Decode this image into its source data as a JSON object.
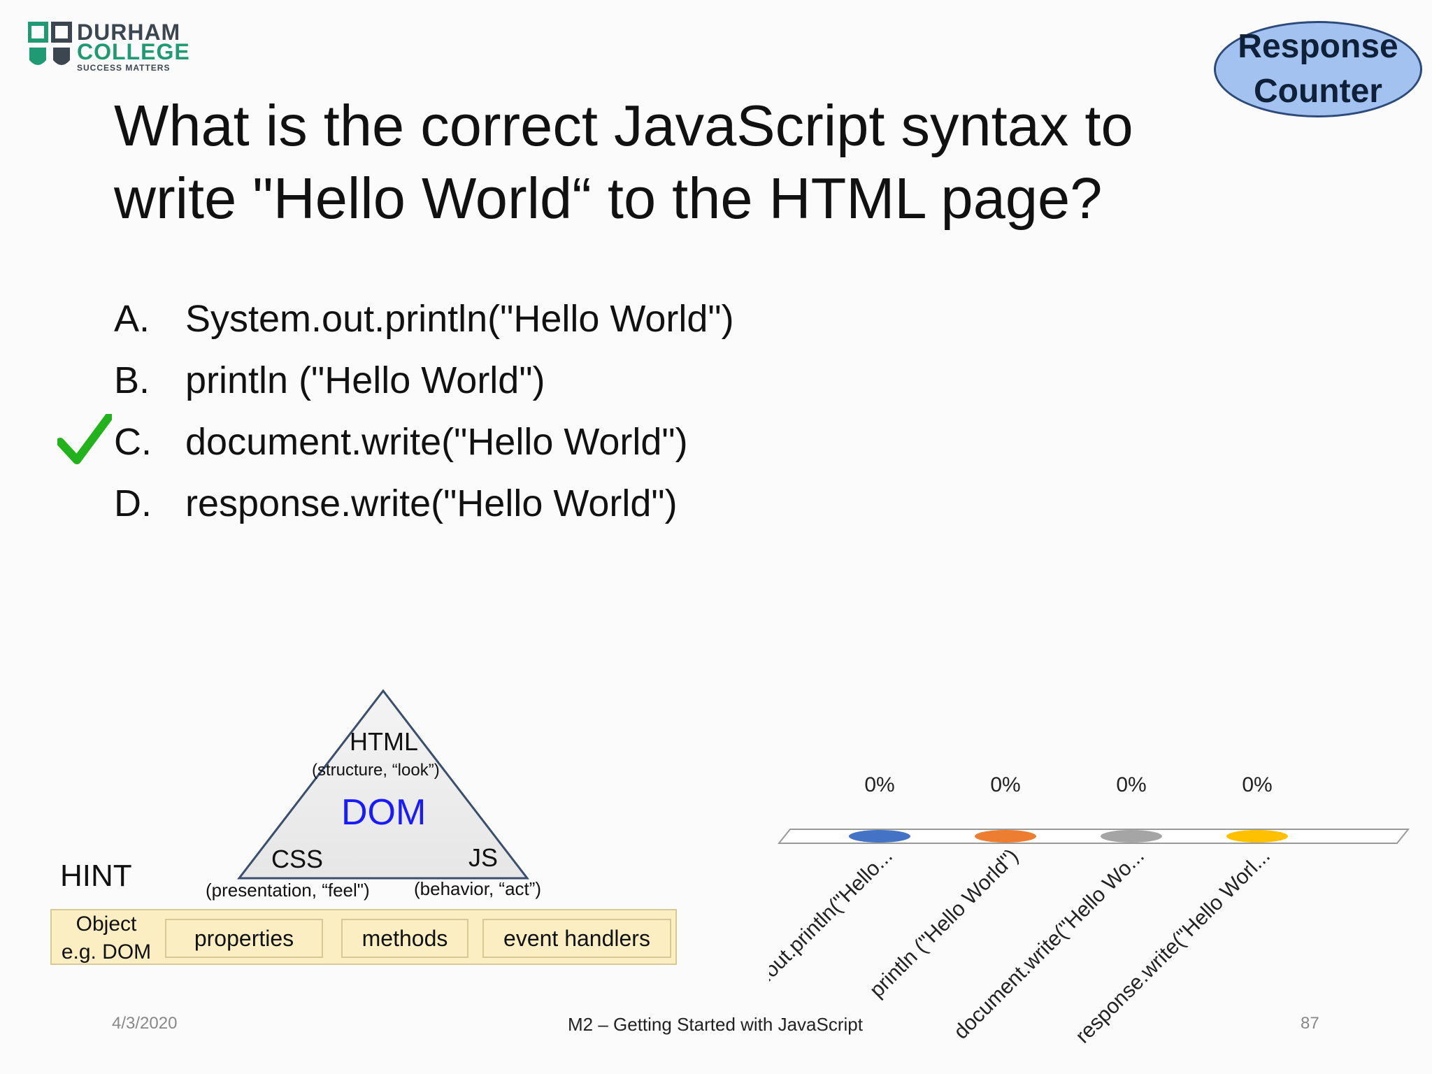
{
  "logo": {
    "line1": "DURHAM",
    "line2": "COLLEGE",
    "line3": "SUCCESS MATTERS"
  },
  "slide": {
    "title": "What is the correct JavaScript syntax to write \"Hello World“ to the HTML page?",
    "response_counter": {
      "line1": "Response",
      "line2": "Counter"
    },
    "options": [
      {
        "letter": "A.",
        "text": "System.out.println(\"Hello World\")"
      },
      {
        "letter": "B.",
        "text": "println (\"Hello World\")"
      },
      {
        "letter": "C.",
        "text": "document.write(\"Hello World\")"
      },
      {
        "letter": "D.",
        "text": "response.write(\"Hello World\")"
      }
    ],
    "correct_option": "C"
  },
  "hint": {
    "label": "HINT",
    "triangle": {
      "top": "HTML",
      "top_sub": "(structure, “look”)",
      "center": "DOM",
      "left": "CSS",
      "left_sub": "(presentation, “feel\")",
      "right": "JS",
      "right_sub": "(behavior, “act”)"
    },
    "object_line1": "Object",
    "object_line2": "e.g. DOM",
    "boxes": [
      "properties",
      "methods",
      "event handlers"
    ]
  },
  "footer": {
    "date": "4/3/2020",
    "title": "M2 – Getting Started with JavaScript",
    "page": "87"
  },
  "colors": {
    "check": "#21b21c",
    "dom": "#1a1aff",
    "series": [
      "#4472c4",
      "#ed7d31",
      "#a5a5a5",
      "#ffc000"
    ]
  },
  "chart_data": {
    "type": "bar",
    "categories": [
      "System.out.println(\"Hello...",
      "println (\"Hello World\")",
      "document.write(\"Hello Wo...",
      "response.write(\"Hello Worl..."
    ],
    "values": [
      0,
      0,
      0,
      0
    ],
    "data_labels": [
      "0%",
      "0%",
      "0%",
      "0%"
    ],
    "title": "",
    "xlabel": "",
    "ylabel": ""
  }
}
